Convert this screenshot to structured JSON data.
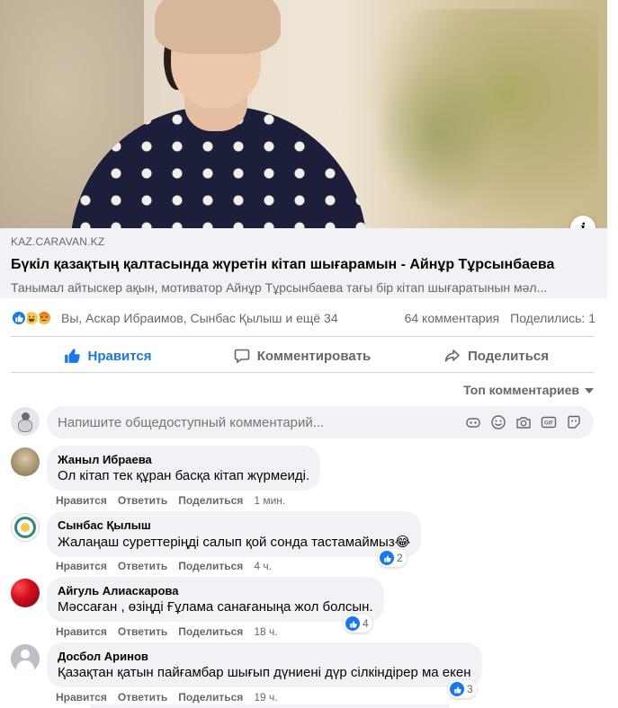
{
  "post": {
    "link": {
      "domain": "KAZ.CARAVAN.KZ",
      "title": "Бүкіл қазақтың қалтасында жүретін кітап шығарамын - Айнұр Тұрсынбаева",
      "description": "Танымал айтыскер ақын, мотиватор Айнұр Тұрсынбаева тағы бір  кітап шығаратынын мәл..."
    },
    "info_button": "i",
    "reactions": {
      "summary": "Вы, Аскар Ибраимов, Сынбас Қылыш и ещё 34",
      "comments_count": "64 комментария",
      "shares_count": "Поделились: 1",
      "types": [
        "like",
        "haha",
        "angry"
      ]
    },
    "actions": {
      "like": "Нравится",
      "comment": "Комментировать",
      "share": "Поделиться"
    },
    "sort_label": "Топ комментариев",
    "composer": {
      "placeholder": "Напишите общедоступный комментарий...",
      "tools": [
        "sticker-icon",
        "emoji-icon",
        "camera-icon",
        "gif-icon",
        "avatar-sticker-icon"
      ]
    }
  },
  "comments": [
    {
      "author": "Жаныл Ибраева",
      "text": "Ол кітап тек құран басқа кітап жүрмеиді.",
      "like": "Нравится",
      "reply": "Ответить",
      "share": "Поделиться",
      "time": "1 мин.",
      "reactions": ""
    },
    {
      "author": "Сынбас Қылыш",
      "text": "Жалаңаш суреттеріңді салып қой сонда тастамаймыз😂",
      "like": "Нравится",
      "reply": "Ответить",
      "share": "Поделиться",
      "time": "4 ч.",
      "reactions": "2"
    },
    {
      "author": "Айгуль Алиаскарова",
      "text": "Мәссаған , өзіңді Ғұлама санағаныңа жол болсын.",
      "like": "Нравится",
      "reply": "Ответить",
      "share": "Поделиться",
      "time": "18 ч.",
      "reactions": "4"
    },
    {
      "author": "Досбол Аринов",
      "text": "Қазақтан қатын пайғамбар шығып дүниені дүр сілкіндірер ма екен",
      "like": "Нравится",
      "reply": "Ответить",
      "share": "Поделиться",
      "time": "19 ч.",
      "reactions": "3"
    }
  ],
  "colors": {
    "accent": "#1877f2",
    "secondary_text": "#65676b",
    "bubble_bg": "#f0f2f5"
  }
}
